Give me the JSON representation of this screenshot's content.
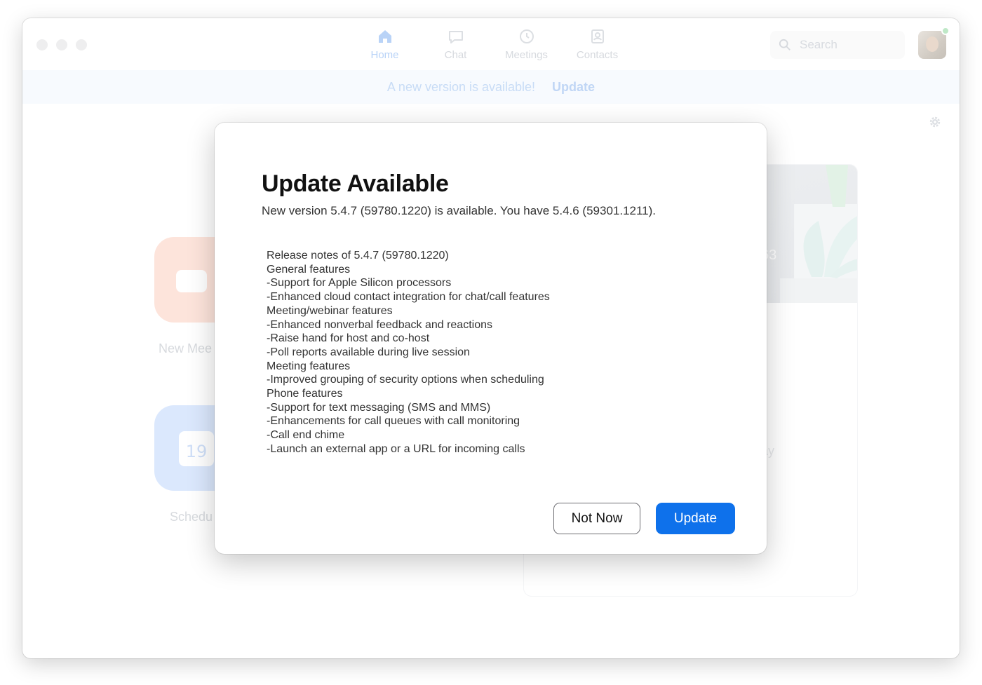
{
  "colors": {
    "primary": "#0e71eb",
    "nav_active": "#b9d3f7",
    "nav_inactive": "#d6d9de",
    "banner_bg": "#f7fafe",
    "new_meeting_tile": "#fde4db",
    "schedule_tile": "#dbe8fd",
    "presence": "#bfe8c7"
  },
  "nav": {
    "items": [
      {
        "label": "Home",
        "icon": "home-icon",
        "active": true
      },
      {
        "label": "Chat",
        "icon": "chat-icon",
        "active": false
      },
      {
        "label": "Meetings",
        "icon": "clock-icon",
        "active": false
      },
      {
        "label": "Contacts",
        "icon": "contact-card-icon",
        "active": false
      }
    ]
  },
  "search": {
    "placeholder": "Search",
    "icon": "search-icon"
  },
  "banner": {
    "text": "A new version is available!",
    "link": "Update"
  },
  "home": {
    "settings_icon": "gear-icon",
    "tiles": [
      {
        "label": "New Mee",
        "icon": "video-camera-icon"
      },
      {
        "label": "Schedu",
        "icon": "calendar-icon",
        "calendar_day": "19"
      }
    ],
    "card": {
      "time_fragment": "63",
      "subtitle_fragment": "ay"
    }
  },
  "dialog": {
    "title": "Update Available",
    "subtitle": "New version 5.4.7 (59780.1220) is available. You have 5.4.6 (59301.1211).",
    "release_notes": [
      "Release notes of 5.4.7 (59780.1220)",
      "General features",
      "-Support for Apple Silicon processors",
      "-Enhanced cloud contact integration for chat/call features",
      "Meeting/webinar features",
      "-Enhanced nonverbal feedback and reactions",
      "-Raise hand for host and co-host",
      "-Poll reports available during live session",
      "Meeting features",
      "-Improved grouping of security options when scheduling",
      "Phone features",
      "-Support for text messaging (SMS and MMS)",
      "-Enhancements for call queues with call monitoring",
      "-Call end chime",
      "-Launch an external app or a URL for incoming calls"
    ],
    "buttons": {
      "not_now": "Not Now",
      "update": "Update"
    }
  }
}
